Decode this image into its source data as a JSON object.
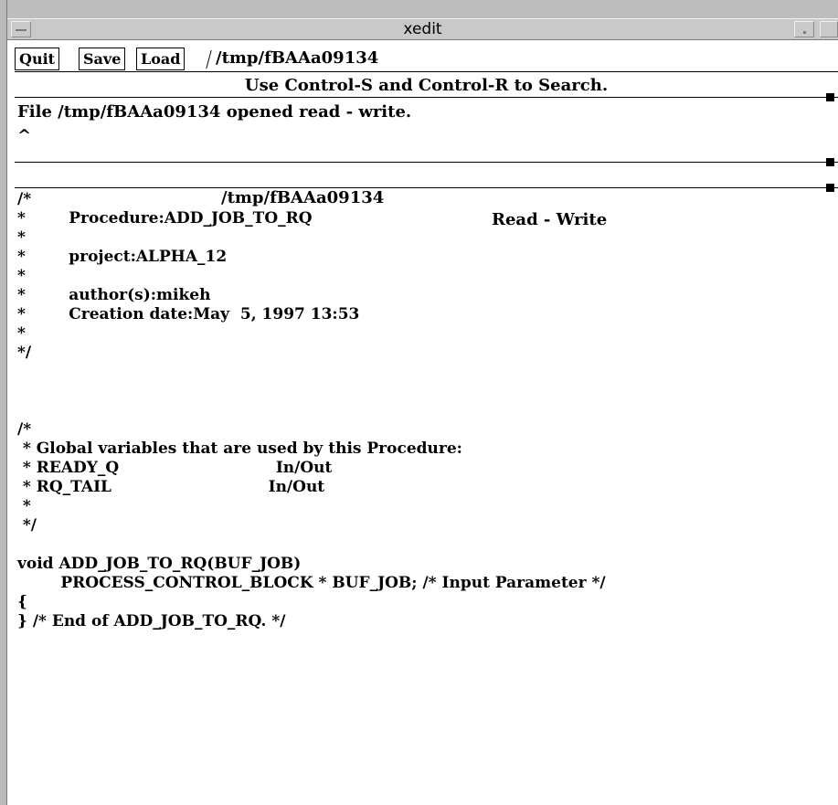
{
  "window": {
    "title": "xedit"
  },
  "toolbar": {
    "quit_label": "Quit",
    "save_label": "Save",
    "load_label": "Load",
    "filename": "/tmp/fBAAa09134"
  },
  "search_hint": "Use Control-S and Control-R to Search.",
  "messages": {
    "line1": "File /tmp/fBAAa09134 opened read - write.",
    "line2": "^"
  },
  "status": {
    "file": "/tmp/fBAAa09134",
    "mode": "Read - Write"
  },
  "editor": {
    "lines": [
      "/*",
      "*        Procedure:ADD_JOB_TO_RQ",
      "*",
      "*        project:ALPHA_12",
      "*",
      "*        author(s):mikeh",
      "*        Creation date:May  5, 1997 13:53",
      "*",
      "*/",
      "",
      "",
      "",
      "/*",
      " * Global variables that are used by this Procedure:",
      " * READY_Q                             In/Out",
      " * RQ_TAIL                             In/Out",
      " *",
      " */",
      "",
      "void ADD_JOB_TO_RQ(BUF_JOB)",
      "        PROCESS_CONTROL_BLOCK * BUF_JOB; /* Input Parameter */",
      "{",
      "} /* End of ADD_JOB_TO_RQ. */"
    ]
  }
}
